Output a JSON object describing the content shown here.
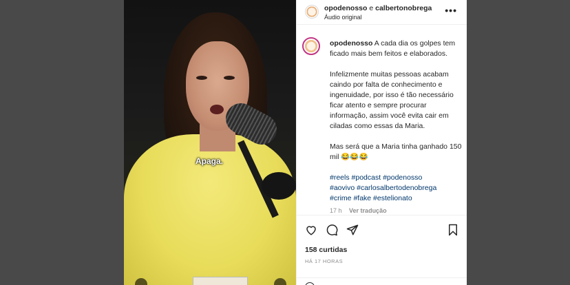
{
  "post": {
    "header": {
      "user1": "opodenosso",
      "conjunction": "e",
      "user2": "calbertonobrega",
      "audio": "Áudio original",
      "more_icon": "more-horizontal-icon"
    },
    "media": {
      "caption": "Apaga."
    },
    "comment": {
      "username": "opodenosso",
      "p1": "A cada dia os golpes tem ficado mais bem feitos e elaborados.",
      "p2": "Infelizmente muitas pessoas acabam caindo por falta de conhecimento e ingenuidade, por isso é tão necessário ficar atento e sempre procurar informação, assim você evita cair em ciladas como essas da Maria.",
      "p3": "Mas será que a Maria tinha ganhado 150 mil 😂😂😂",
      "hashtags": [
        "#reels",
        "#podcast",
        "#podenosso",
        "#aovivo",
        "#carlosalbertodenobrega",
        "#crime",
        "#fake",
        "#estelionato"
      ],
      "age": "17 h",
      "translate": "Ver tradução"
    },
    "actions": {
      "likes": "158 curtidas",
      "time": "HÁ 17 HORAS"
    }
  }
}
